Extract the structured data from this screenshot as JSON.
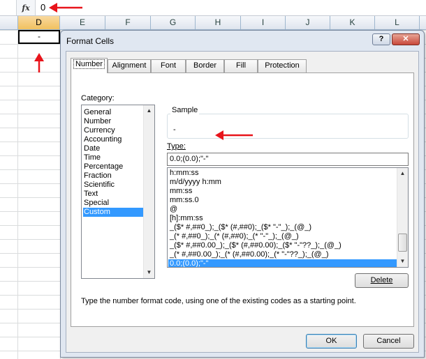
{
  "formula_bar": {
    "fx_label": "fx",
    "value": "0"
  },
  "sheet": {
    "columns": [
      "D",
      "E",
      "F",
      "G",
      "H",
      "I",
      "J",
      "K",
      "L"
    ],
    "cell_d1_value": "-"
  },
  "dialog": {
    "title": "Format Cells",
    "help_label": "?",
    "close_label": "✕",
    "tabs": [
      "Number",
      "Alignment",
      "Font",
      "Border",
      "Fill",
      "Protection"
    ],
    "category_label": "Category:",
    "categories": [
      "General",
      "Number",
      "Currency",
      "Accounting",
      "Date",
      "Time",
      "Percentage",
      "Fraction",
      "Scientific",
      "Text",
      "Special",
      "Custom"
    ],
    "selected_category": "Custom",
    "sample_label": "Sample",
    "sample_value": "-",
    "type_label": "Type:",
    "type_value": "0.0;(0.0);\"-\"",
    "format_codes": [
      "h:mm:ss",
      "m/d/yyyy h:mm",
      "mm:ss",
      "mm:ss.0",
      "@",
      "[h]:mm:ss",
      "_($* #,##0_);_($* (#,##0);_($* \"-\"_);_(@_)",
      "_(* #,##0_);_(* (#,##0);_(* \"-\"_);_(@_)",
      "_($* #,##0.00_);_($* (#,##0.00);_($* \"-\"??_);_(@_)",
      "_(* #,##0.00_);_(* (#,##0.00);_(* \"-\"??_);_(@_)",
      "0.0;(0.0);\"-\""
    ],
    "selected_format": "0.0;(0.0);\"-\"",
    "delete_label": "Delete",
    "description": "Type the number format code, using one of the existing codes as a starting point.",
    "ok_label": "OK",
    "cancel_label": "Cancel"
  },
  "colors": {
    "accent_selection": "#3399ff",
    "arrow_red": "#e8141b"
  }
}
